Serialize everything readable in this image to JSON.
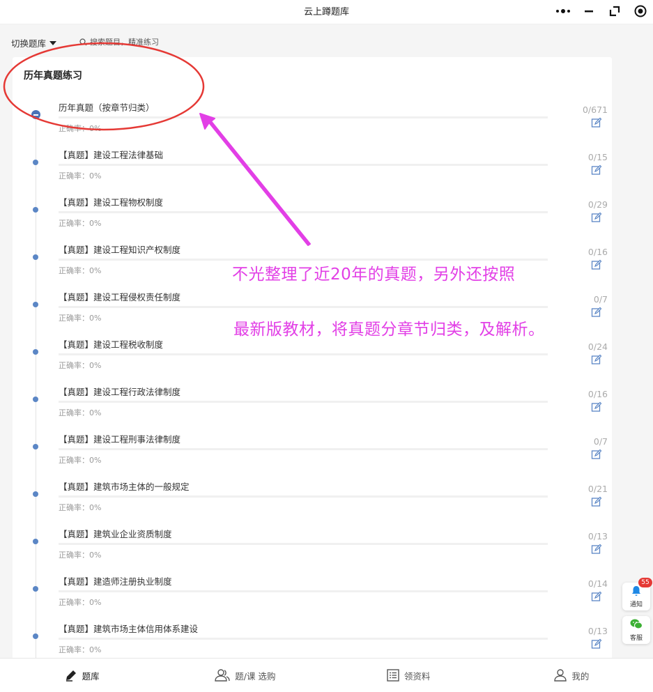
{
  "app": {
    "title": "云上蹲题库"
  },
  "toolbar": {
    "switch_label": "切换题库",
    "search_placeholder": "搜索题目，精准练习"
  },
  "section": {
    "title": "历年真题练习"
  },
  "items": [
    {
      "name": "历年真题（按章节归类）",
      "accuracy": "正确率：0%",
      "count": "0/671",
      "is_parent": true
    },
    {
      "name": "【真题】建设工程法律基础",
      "accuracy": "正确率：0%",
      "count": "0/15"
    },
    {
      "name": "【真题】建设工程物权制度",
      "accuracy": "正确率：0%",
      "count": "0/29"
    },
    {
      "name": "【真题】建设工程知识产权制度",
      "accuracy": "正确率：0%",
      "count": "0/16"
    },
    {
      "name": "【真题】建设工程侵权责任制度",
      "accuracy": "正确率：0%",
      "count": "0/7"
    },
    {
      "name": "【真题】建设工程税收制度",
      "accuracy": "正确率：0%",
      "count": "0/24"
    },
    {
      "name": "【真题】建设工程行政法律制度",
      "accuracy": "正确率：0%",
      "count": "0/16"
    },
    {
      "name": "【真题】建设工程刑事法律制度",
      "accuracy": "正确率：0%",
      "count": "0/7"
    },
    {
      "name": "【真题】建筑市场主体的一般规定",
      "accuracy": "正确率：0%",
      "count": "0/21"
    },
    {
      "name": "【真题】建筑业企业资质制度",
      "accuracy": "正确率：0%",
      "count": "0/13"
    },
    {
      "name": "【真题】建造师注册执业制度",
      "accuracy": "正确率：0%",
      "count": "0/14"
    },
    {
      "name": "【真题】建筑市场主体信用体系建设",
      "accuracy": "正确率：0%",
      "count": "0/13"
    }
  ],
  "annotation": {
    "line1": "不光整理了近20年的真题，另外还按照",
    "line2": "最新版教材，将真题分章节归类，及解析。",
    "color": "#e23fe6",
    "circle_color": "#e53935"
  },
  "float_buttons": {
    "notify_label": "通知",
    "notify_badge": "55",
    "service_label": "客服"
  },
  "bottom_nav": [
    {
      "label": "题库",
      "icon": "pencil-icon"
    },
    {
      "label": "题/课 选购",
      "icon": "users-icon"
    },
    {
      "label": "领资料",
      "icon": "list-icon"
    },
    {
      "label": "我的",
      "icon": "user-icon"
    }
  ]
}
